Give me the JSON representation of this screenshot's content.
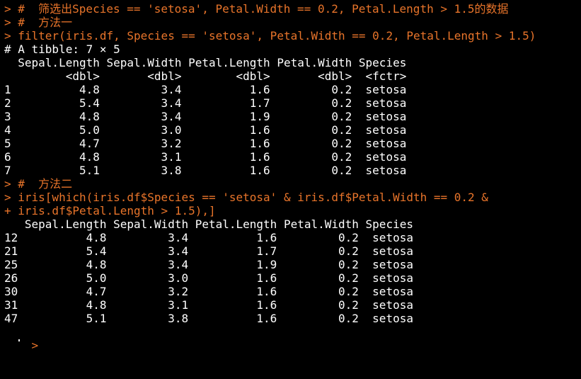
{
  "console": {
    "colors": {
      "background": "#000000",
      "input": "#e8742a",
      "output": "#ffffff"
    },
    "lines": [
      {
        "kind": "cmd",
        "text": "> #  筛选出Species == 'setosa', Petal.Width == 0.2, Petal.Length > 1.5的数据"
      },
      {
        "kind": "cmd",
        "text": "> #  方法一"
      },
      {
        "kind": "cmd",
        "text": "> filter(iris.df, Species == 'setosa', Petal.Width == 0.2, Petal.Length > 1.5)"
      },
      {
        "kind": "out",
        "text": "# A tibble: 7 × 5"
      },
      {
        "kind": "out",
        "text": "  Sepal.Length Sepal.Width Petal.Length Petal.Width Species"
      },
      {
        "kind": "out",
        "text": "         <dbl>       <dbl>        <dbl>       <dbl>  <fctr>"
      },
      {
        "kind": "out",
        "text": "1          4.8         3.4          1.6         0.2  setosa"
      },
      {
        "kind": "out",
        "text": "2          5.4         3.4          1.7         0.2  setosa"
      },
      {
        "kind": "out",
        "text": "3          4.8         3.4          1.9         0.2  setosa"
      },
      {
        "kind": "out",
        "text": "4          5.0         3.0          1.6         0.2  setosa"
      },
      {
        "kind": "out",
        "text": "5          4.7         3.2          1.6         0.2  setosa"
      },
      {
        "kind": "out",
        "text": "6          4.8         3.1          1.6         0.2  setosa"
      },
      {
        "kind": "out",
        "text": "7          5.1         3.8          1.6         0.2  setosa"
      },
      {
        "kind": "cmd",
        "text": "> #  方法二"
      },
      {
        "kind": "cmd",
        "text": "> iris[which(iris.df$Species == 'setosa' & iris.df$Petal.Width == 0.2 &"
      },
      {
        "kind": "cmd",
        "text": "+ iris.df$Petal.Length > 1.5),]"
      },
      {
        "kind": "out",
        "text": "   Sepal.Length Sepal.Width Petal.Length Petal.Width Species"
      },
      {
        "kind": "out",
        "text": "12          4.8         3.4          1.6         0.2  setosa"
      },
      {
        "kind": "out",
        "text": "21          5.4         3.4          1.7         0.2  setosa"
      },
      {
        "kind": "out",
        "text": "25          4.8         3.4          1.9         0.2  setosa"
      },
      {
        "kind": "out",
        "text": "26          5.0         3.0          1.6         0.2  setosa"
      },
      {
        "kind": "out",
        "text": "30          4.7         3.2          1.6         0.2  setosa"
      },
      {
        "kind": "out",
        "text": "31          4.8         3.1          1.6         0.2  setosa"
      },
      {
        "kind": "out",
        "text": "47          5.1         3.8          1.6         0.2  setosa"
      },
      {
        "kind": "cmd",
        "text": "> "
      }
    ]
  }
}
